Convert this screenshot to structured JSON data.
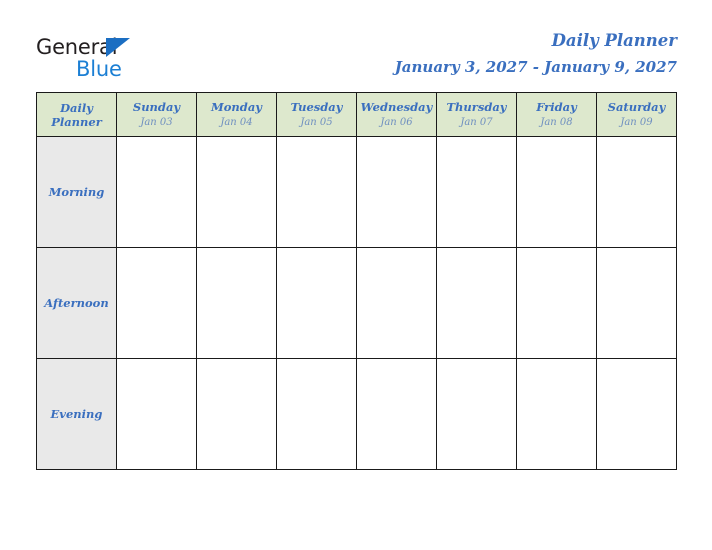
{
  "brand": {
    "name_part1": "General",
    "name_part2": "Blue",
    "triangle_color": "#1b6ec2",
    "part1_color": "#231f20",
    "part2_color": "#1b7fd4"
  },
  "header": {
    "title": "Daily Planner",
    "date_range": "January 3, 2027 - January 9, 2027",
    "title_color": "#3a6fbf"
  },
  "table": {
    "corner_label_line1": "Daily",
    "corner_label_line2": "Planner",
    "header_background": "#dde8cd",
    "row_label_background": "#e9e9e9",
    "cell_background": "#ffffff",
    "border_color": "#1a1a1a",
    "columns": [
      {
        "day": "Sunday",
        "date": "Jan 03"
      },
      {
        "day": "Monday",
        "date": "Jan 04"
      },
      {
        "day": "Tuesday",
        "date": "Jan 05"
      },
      {
        "day": "Wednesday",
        "date": "Jan 06"
      },
      {
        "day": "Thursday",
        "date": "Jan 07"
      },
      {
        "day": "Friday",
        "date": "Jan 08"
      },
      {
        "day": "Saturday",
        "date": "Jan 09"
      }
    ],
    "rows": [
      {
        "label": "Morning",
        "cells": [
          "",
          "",
          "",
          "",
          "",
          "",
          ""
        ]
      },
      {
        "label": "Afternoon",
        "cells": [
          "",
          "",
          "",
          "",
          "",
          "",
          ""
        ]
      },
      {
        "label": "Evening",
        "cells": [
          "",
          "",
          "",
          "",
          "",
          "",
          ""
        ]
      }
    ]
  }
}
